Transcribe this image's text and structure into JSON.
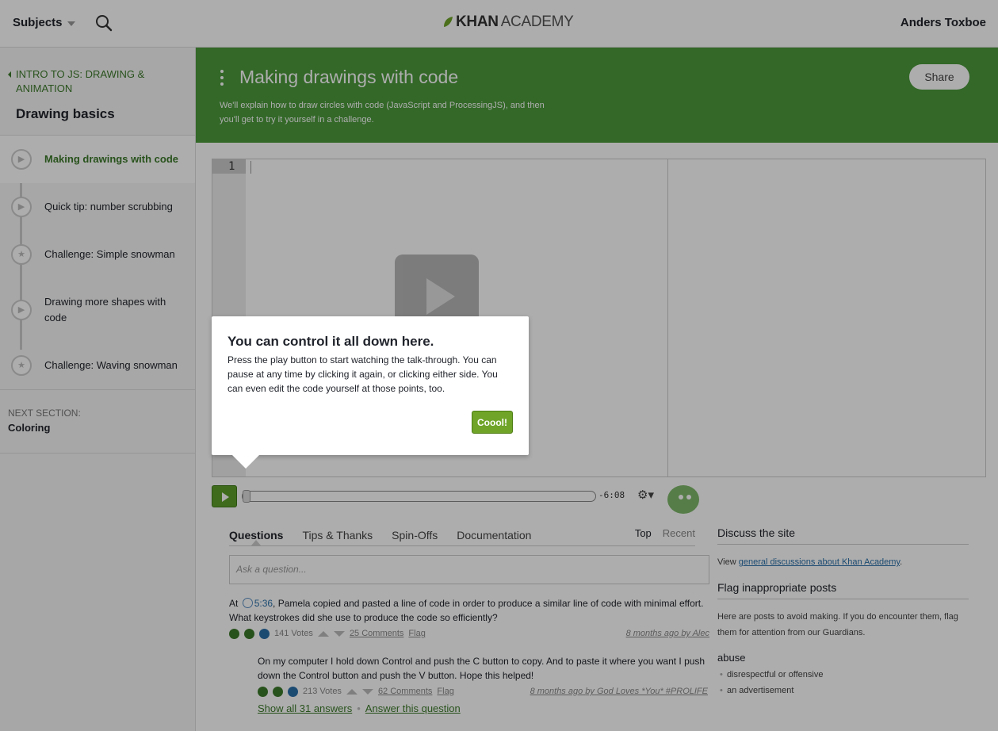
{
  "nav": {
    "subjects": "Subjects",
    "logo_bold": "KHAN",
    "logo_rest": "ACADEMY",
    "user": "Anders Toxboe"
  },
  "sidebar": {
    "back": "INTRO TO JS: DRAWING & ANIMATION",
    "title": "Drawing basics",
    "items": [
      {
        "label": "Making drawings with code",
        "icon": "video-icon"
      },
      {
        "label": "Quick tip: number scrubbing",
        "icon": "video-icon"
      },
      {
        "label": "Challenge: Simple snowman",
        "icon": "star-icon"
      },
      {
        "label": "Drawing more shapes with code",
        "icon": "video-icon"
      },
      {
        "label": "Challenge: Waving snowman",
        "icon": "star-icon"
      }
    ],
    "next_label": "NEXT SECTION:",
    "next_value": "Coloring"
  },
  "banner": {
    "title": "Making drawings with code",
    "description": "We'll explain how to draw circles with code (JavaScript and ProcessingJS), and then you'll get to try it yourself in a challenge.",
    "share": "Share",
    "color": "#4c9a3c"
  },
  "editor": {
    "line_number": "1"
  },
  "player": {
    "time_left": "-6:08"
  },
  "tooltip": {
    "title": "You can control it all down here.",
    "body": "Press the play button to start watching the talk-through. You can pause at any time by clicking it again, or clicking either side. You can even edit the code yourself at those points, too.",
    "button": "Coool!"
  },
  "discussion": {
    "tabs": [
      "Questions",
      "Tips & Thanks",
      "Spin-Offs",
      "Documentation"
    ],
    "sort_top": "Top",
    "sort_recent": "Recent",
    "ask_placeholder": "Ask a question...",
    "question": {
      "prefix": "At",
      "time": "5:36",
      "text": ", Pamela copied and pasted a line of code in order to produce a similar line of code with minimal effort. What keystrokes did she use to produce the code so efficiently?",
      "votes": "141 Votes",
      "comments": "25 Comments",
      "flag": "Flag",
      "when": "8 months ago",
      "by": "by",
      "author": "Alec"
    },
    "answer": {
      "text": "On my computer I hold down Control and push the C button to copy. And to paste it where you want I push down the Control button and push the V button. Hope this helped!",
      "votes": "213 Votes",
      "comments": "62 Comments",
      "flag": "Flag",
      "when": "8 months ago",
      "by": "by",
      "author": "God Loves *You* #PROLIFE"
    },
    "show_all": "Show all 31 answers",
    "answer_link": "Answer this question"
  },
  "rightcol": {
    "discuss_title": "Discuss the site",
    "view_prefix": "View",
    "view_link": "general discussions about Khan Academy",
    "view_suffix": ".",
    "flag_title": "Flag inappropriate posts",
    "flag_desc": "Here are posts to avoid making. If you do encounter them, flag them for attention from our Guardians.",
    "abuse_title": "abuse",
    "abuse_items": [
      "disrespectful or offensive",
      "an advertisement"
    ]
  }
}
